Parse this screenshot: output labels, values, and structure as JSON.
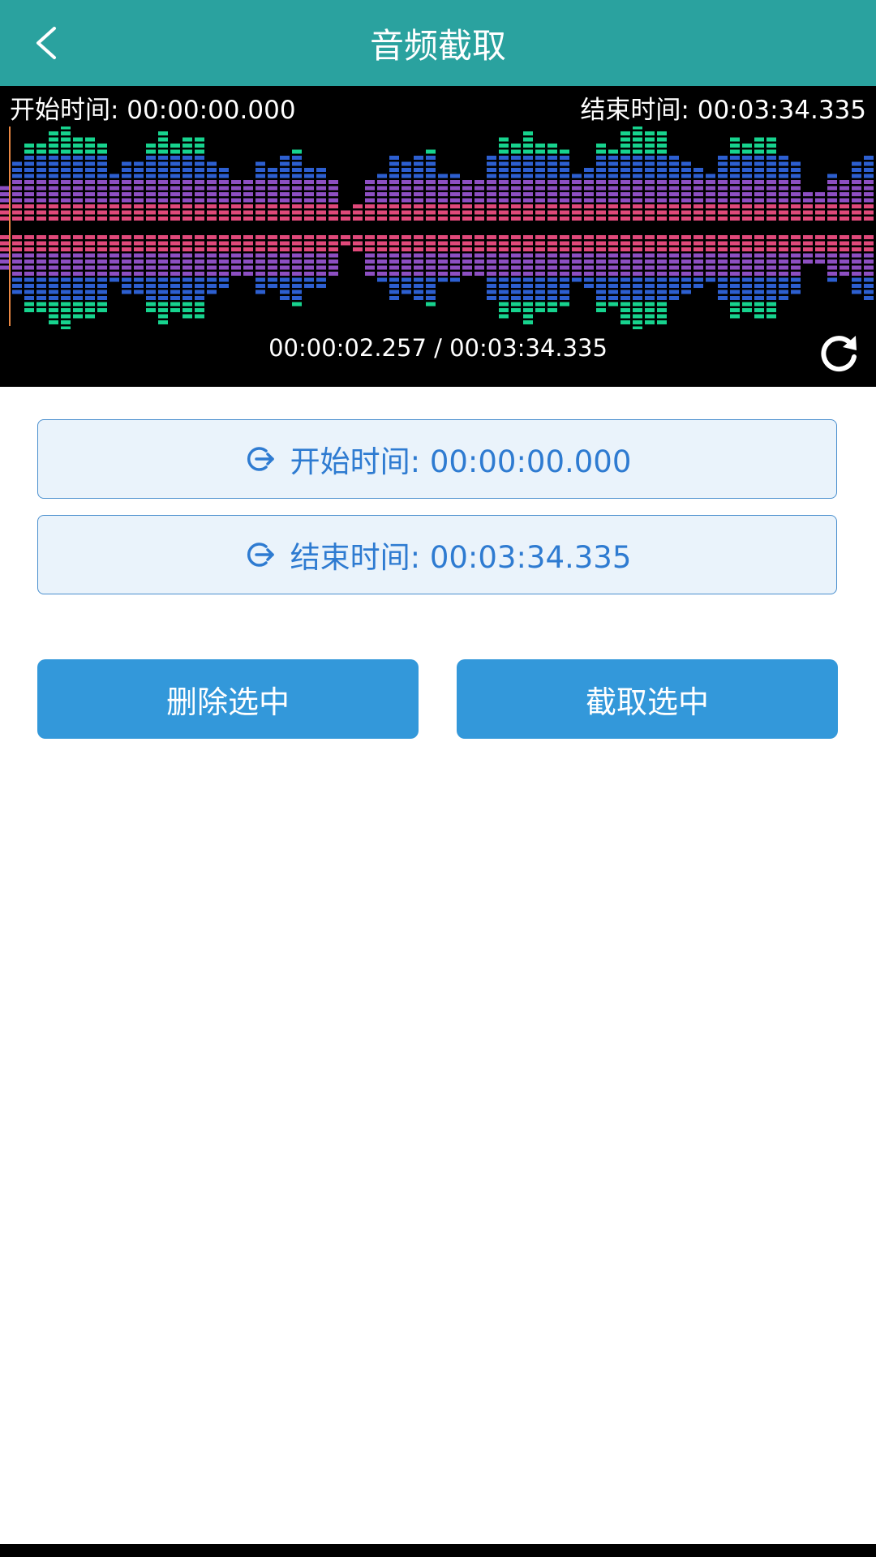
{
  "header": {
    "title": "音频截取",
    "back_icon": "chevron-left-icon",
    "color": "#2aa29f"
  },
  "waveform": {
    "start_label": "开始时间: 00:00:00.000",
    "end_label": "结束时间: 00:03:34.335",
    "progress_label": "00:00:02.257 / 00:03:34.335",
    "refresh_icon": "refresh-icon",
    "colors": {
      "peak": "#17d38e",
      "mid": "#2d5fd0",
      "low": "#8d4fc2",
      "base": "#e0497a",
      "background": "#000000"
    }
  },
  "controls": {
    "start_button_label": "开始时间: 00:00:00.000",
    "end_button_label": "结束时间: 00:03:34.335",
    "time_icon": "logout-arrow-icon",
    "delete_button_label": "删除选中",
    "cut_button_label": "截取选中",
    "accent": "#3398da"
  }
}
